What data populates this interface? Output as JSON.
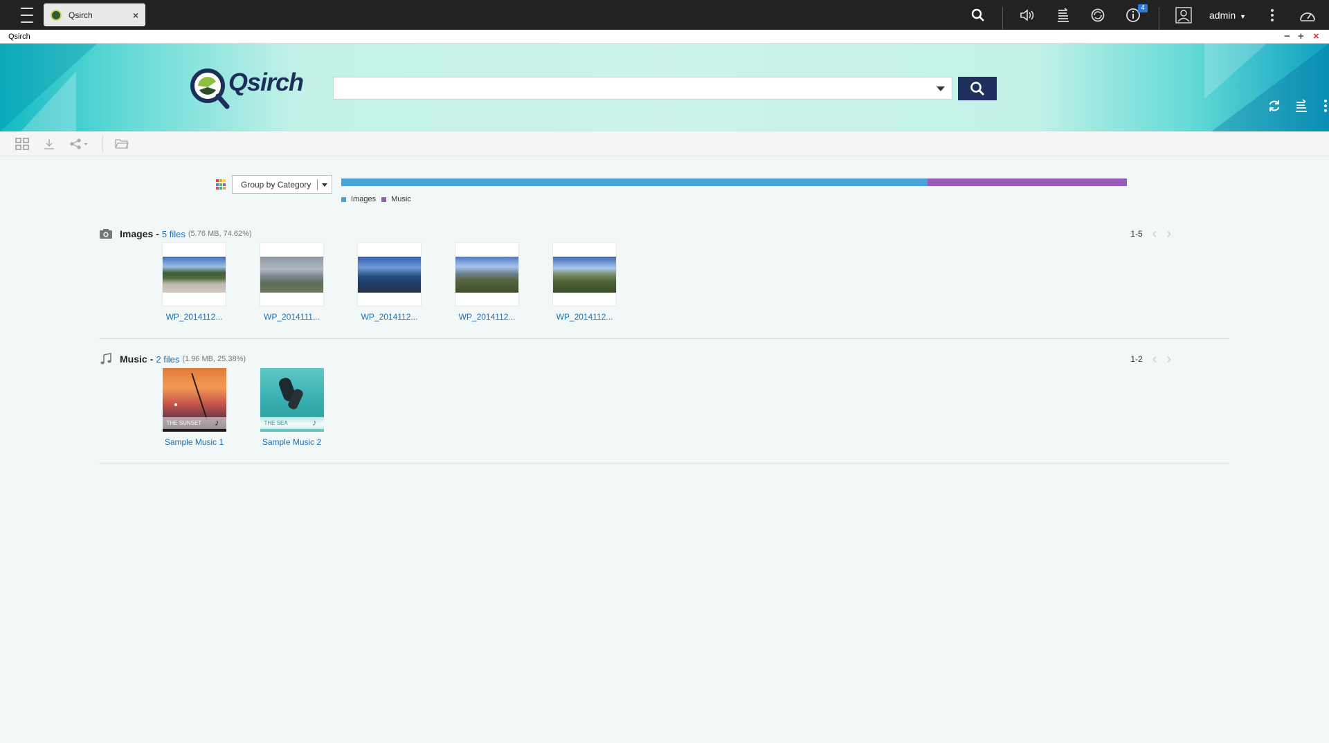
{
  "topbar": {
    "tab_title": "Qsirch",
    "info_badge": "4",
    "user": "admin",
    "icons": [
      "menu-icon",
      "search-icon",
      "volume-icon",
      "stack-icon",
      "sync-icon",
      "info-icon",
      "user-icon",
      "more-vertical-icon",
      "dashboard-gauge-icon"
    ]
  },
  "window": {
    "title": "Qsirch"
  },
  "header": {
    "logo_text": "Qsirch",
    "search_value": "",
    "search_placeholder": ""
  },
  "toolbar": {
    "icons": [
      "select-all-icon",
      "download-icon",
      "share-icon",
      "open-folder-icon"
    ]
  },
  "filter": {
    "group_by": "Group by Category",
    "legend": [
      {
        "name": "Images",
        "color": "#4aa3d8",
        "percent": 74.62
      },
      {
        "name": "Music",
        "color": "#9a5cba",
        "percent": 25.38
      }
    ]
  },
  "images": {
    "name": "Images",
    "count_text": "5 files",
    "meta": "(5.76 MB, 74.62%)",
    "range": "1-5",
    "files": [
      {
        "name": "WP_2014112..."
      },
      {
        "name": "WP_2014111..."
      },
      {
        "name": "WP_2014112..."
      },
      {
        "name": "WP_2014112..."
      },
      {
        "name": "WP_2014112..."
      }
    ]
  },
  "music": {
    "name": "Music",
    "count_text": "2 files",
    "meta": "(1.96 MB, 25.38%)",
    "range": "1-2",
    "files": [
      {
        "name": "Sample Music 1",
        "cover_text": "THE SUNSET"
      },
      {
        "name": "Sample Music 2",
        "cover_text": "THE SEA"
      }
    ]
  },
  "colors": {
    "accent": "#1d6fb8",
    "search_button": "#1f2f5e",
    "topbar": "#222222",
    "images_series": "#4aa3d8",
    "music_series": "#9a5cba"
  }
}
